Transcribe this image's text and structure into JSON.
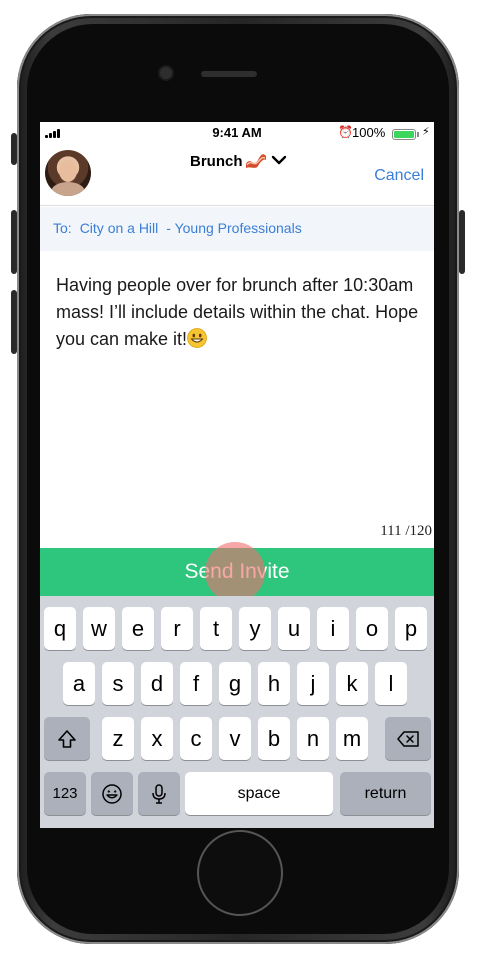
{
  "status_bar": {
    "time": "9:41 AM",
    "battery_percent": "100%",
    "battery_color": "#3dd65c"
  },
  "header": {
    "title": "Brunch",
    "title_emoji": "bacon-icon",
    "cancel_label": "Cancel"
  },
  "recipients": {
    "prefix": "To:",
    "group": "City on a Hill",
    "subgroup": "- Young Professionals"
  },
  "message": {
    "text": "Having people over for brunch after 10:30am mass! I’ll include details within the chat. Hope you can make it!",
    "trailing_emoji": "grinning-face-icon",
    "char_count": "111 /120"
  },
  "send_button": {
    "label": "Send Invite",
    "color": "#2ec57d"
  },
  "keyboard": {
    "row1": [
      "q",
      "w",
      "e",
      "r",
      "t",
      "y",
      "u",
      "i",
      "o",
      "p"
    ],
    "row2": [
      "a",
      "s",
      "d",
      "f",
      "g",
      "h",
      "j",
      "k",
      "l"
    ],
    "row3": [
      "z",
      "x",
      "c",
      "v",
      "b",
      "n",
      "m"
    ],
    "numbers_label": "123",
    "space_label": "space",
    "return_label": "return"
  },
  "colors": {
    "accent_blue": "#3a7ed6",
    "recipient_bg": "#f2f6fb",
    "keyboard_bg": "#d1d4da",
    "touch_indicator": "#f06e6e"
  }
}
